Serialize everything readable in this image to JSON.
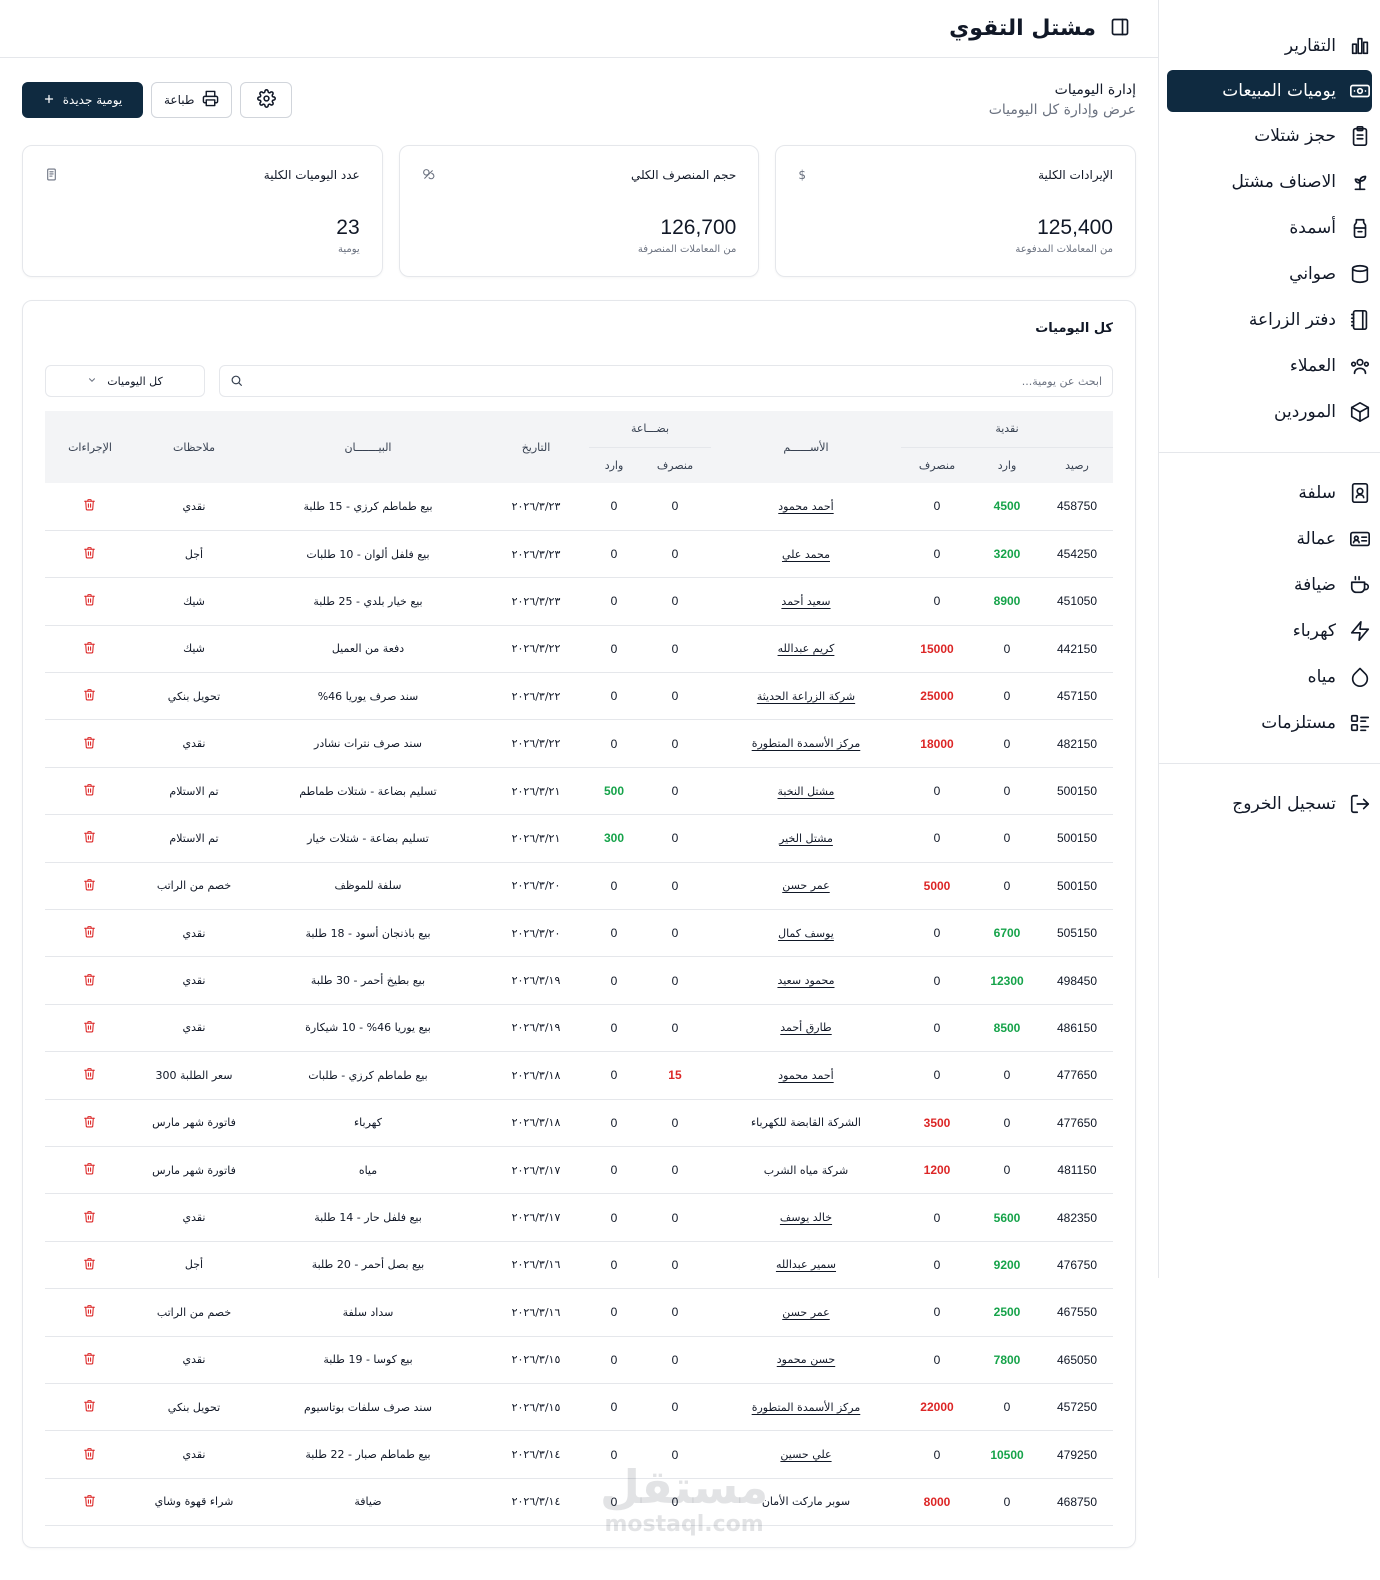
{
  "app": {
    "title": "مشتل التقوي"
  },
  "sidebar": {
    "groups": [
      [
        {
          "label": "التقارير",
          "icon": "bar-chart-icon",
          "active": false
        },
        {
          "label": "يوميات المبيعات",
          "icon": "banknote-icon",
          "active": true
        },
        {
          "label": "حجز شتلات",
          "icon": "clipboard-icon",
          "active": false
        },
        {
          "label": "الاصناف مشتل",
          "icon": "sprout-icon",
          "active": false
        },
        {
          "label": "أسمدة",
          "icon": "fertilizer-icon",
          "active": false
        },
        {
          "label": "صواني",
          "icon": "cylinder-icon",
          "active": false
        },
        {
          "label": "دفتر الزراعة",
          "icon": "notebook-icon",
          "active": false
        },
        {
          "label": "العملاء",
          "icon": "users-icon",
          "active": false
        },
        {
          "label": "الموردين",
          "icon": "package-icon",
          "active": false
        }
      ],
      [
        {
          "label": "سلفة",
          "icon": "contact-icon",
          "active": false
        },
        {
          "label": "عمالة",
          "icon": "id-card-icon",
          "active": false
        },
        {
          "label": "ضيافة",
          "icon": "coffee-icon",
          "active": false
        },
        {
          "label": "كهرباء",
          "icon": "zap-icon",
          "active": false
        },
        {
          "label": "مياه",
          "icon": "droplet-icon",
          "active": false
        },
        {
          "label": "مستلزمات",
          "icon": "list-icon",
          "active": false
        }
      ],
      [
        {
          "label": "تسجيل الخروج",
          "icon": "logout-icon",
          "active": false
        }
      ]
    ]
  },
  "page": {
    "heading": "إدارة اليوميات",
    "subheading": "عرض وإدارة كل اليوميات"
  },
  "toolbar": {
    "new_label": "يومية جديدة",
    "print_label": "طباعة"
  },
  "stats": [
    {
      "label": "الإيرادات الكلية",
      "value": "125,400",
      "note": "من المعاملات المدفوعة",
      "icon": "dollar-icon"
    },
    {
      "label": "حجم المنصرف الكلي",
      "value": "126,700",
      "note": "من المعاملات المنصرفة",
      "icon": "coins-icon"
    },
    {
      "label": "عدد اليوميات الكلية",
      "value": "23",
      "note": "يومية",
      "icon": "receipt-icon"
    }
  ],
  "table": {
    "title": "كل اليوميات",
    "search_placeholder": "ابحث عن يومية...",
    "filter_value": "كل اليوميات",
    "headers": {
      "cash": "نقدية",
      "goods": "بضـــاعة",
      "balance": "رصيد",
      "incoming": "وارد",
      "outgoing": "منصرف",
      "name": "الأســــــم",
      "date": "التاريخ",
      "statement": "البيـــــــان",
      "notes": "ملاحظات",
      "actions": "الإجراءات"
    },
    "colors": {
      "incoming": "#16a34a",
      "outgoing": "#dc2626"
    },
    "rows": [
      {
        "balance": "458750",
        "cash_in": "4500",
        "cash_out": "0",
        "name": "أحمد محمود",
        "linked": true,
        "goods_out": "0",
        "goods_in": "0",
        "date": "٢٠٢٦/٣/٢٣",
        "statement": "بيع طماطم كرزي - 15 طلبة",
        "notes": "نقدي"
      },
      {
        "balance": "454250",
        "cash_in": "3200",
        "cash_out": "0",
        "name": "محمد علي",
        "linked": true,
        "goods_out": "0",
        "goods_in": "0",
        "date": "٢٠٢٦/٣/٢٣",
        "statement": "بيع فلفل ألوان - 10 طلبات",
        "notes": "أجل"
      },
      {
        "balance": "451050",
        "cash_in": "8900",
        "cash_out": "0",
        "name": "سعيد أحمد",
        "linked": true,
        "goods_out": "0",
        "goods_in": "0",
        "date": "٢٠٢٦/٣/٢٣",
        "statement": "بيع خيار بلدي - 25 طلبة",
        "notes": "شيك"
      },
      {
        "balance": "442150",
        "cash_in": "0",
        "cash_out": "15000",
        "name": "كريم عبدالله",
        "linked": true,
        "goods_out": "0",
        "goods_in": "0",
        "date": "٢٠٢٦/٣/٢٢",
        "statement": "دفعة من العميل",
        "notes": "شيك"
      },
      {
        "balance": "457150",
        "cash_in": "0",
        "cash_out": "25000",
        "name": "شركة الزراعة الحديثة",
        "linked": true,
        "goods_out": "0",
        "goods_in": "0",
        "date": "٢٠٢٦/٣/٢٢",
        "statement": "سند صرف يوريا 46%",
        "notes": "تحويل بنكي"
      },
      {
        "balance": "482150",
        "cash_in": "0",
        "cash_out": "18000",
        "name": "مركز الأسمدة المتطورة",
        "linked": true,
        "goods_out": "0",
        "goods_in": "0",
        "date": "٢٠٢٦/٣/٢٢",
        "statement": "سند صرف نترات نشادر",
        "notes": "نقدي"
      },
      {
        "balance": "500150",
        "cash_in": "0",
        "cash_out": "0",
        "name": "مشتل النخبة",
        "linked": true,
        "goods_out": "0",
        "goods_in": "500",
        "date": "٢٠٢٦/٣/٢١",
        "statement": "تسليم بضاعة - شتلات طماطم",
        "notes": "تم الاستلام"
      },
      {
        "balance": "500150",
        "cash_in": "0",
        "cash_out": "0",
        "name": "مشتل الخير",
        "linked": true,
        "goods_out": "0",
        "goods_in": "300",
        "date": "٢٠٢٦/٣/٢١",
        "statement": "تسليم بضاعة - شتلات خيار",
        "notes": "تم الاستلام"
      },
      {
        "balance": "500150",
        "cash_in": "0",
        "cash_out": "5000",
        "name": "عمر حسن",
        "linked": true,
        "goods_out": "0",
        "goods_in": "0",
        "date": "٢٠٢٦/٣/٢٠",
        "statement": "سلفة للموظف",
        "notes": "خصم من الراتب"
      },
      {
        "balance": "505150",
        "cash_in": "6700",
        "cash_out": "0",
        "name": "يوسف كمال",
        "linked": true,
        "goods_out": "0",
        "goods_in": "0",
        "date": "٢٠٢٦/٣/٢٠",
        "statement": "بيع باذنجان أسود - 18 طلبة",
        "notes": "نقدي"
      },
      {
        "balance": "498450",
        "cash_in": "12300",
        "cash_out": "0",
        "name": "محمود سعيد",
        "linked": true,
        "goods_out": "0",
        "goods_in": "0",
        "date": "٢٠٢٦/٣/١٩",
        "statement": "بيع بطيخ أحمر - 30 طلبة",
        "notes": "نقدي"
      },
      {
        "balance": "486150",
        "cash_in": "8500",
        "cash_out": "0",
        "name": "طارق أحمد",
        "linked": true,
        "goods_out": "0",
        "goods_in": "0",
        "date": "٢٠٢٦/٣/١٩",
        "statement": "بيع يوريا 46% - 10 شيكارة",
        "notes": "نقدي"
      },
      {
        "balance": "477650",
        "cash_in": "0",
        "cash_out": "0",
        "name": "أحمد محمود",
        "linked": true,
        "goods_out": "15",
        "goods_in": "0",
        "date": "٢٠٢٦/٣/١٨",
        "statement": "بيع طماطم كرزي - طلبات",
        "notes": "سعر الطلبة 300"
      },
      {
        "balance": "477650",
        "cash_in": "0",
        "cash_out": "3500",
        "name": "الشركة القابضة للكهرباء",
        "linked": false,
        "goods_out": "0",
        "goods_in": "0",
        "date": "٢٠٢٦/٣/١٨",
        "statement": "كهرباء",
        "notes": "فاتورة شهر مارس"
      },
      {
        "balance": "481150",
        "cash_in": "0",
        "cash_out": "1200",
        "name": "شركة مياه الشرب",
        "linked": false,
        "goods_out": "0",
        "goods_in": "0",
        "date": "٢٠٢٦/٣/١٧",
        "statement": "مياه",
        "notes": "فاتورة شهر مارس"
      },
      {
        "balance": "482350",
        "cash_in": "5600",
        "cash_out": "0",
        "name": "خالد يوسف",
        "linked": true,
        "goods_out": "0",
        "goods_in": "0",
        "date": "٢٠٢٦/٣/١٧",
        "statement": "بيع فلفل حار - 14 طلبة",
        "notes": "نقدي"
      },
      {
        "balance": "476750",
        "cash_in": "9200",
        "cash_out": "0",
        "name": "سمير عبدالله",
        "linked": true,
        "goods_out": "0",
        "goods_in": "0",
        "date": "٢٠٢٦/٣/١٦",
        "statement": "بيع بصل أحمر - 20 طلبة",
        "notes": "أجل"
      },
      {
        "balance": "467550",
        "cash_in": "2500",
        "cash_out": "0",
        "name": "عمر حسن",
        "linked": true,
        "goods_out": "0",
        "goods_in": "0",
        "date": "٢٠٢٦/٣/١٦",
        "statement": "سداد سلفة",
        "notes": "خصم من الراتب"
      },
      {
        "balance": "465050",
        "cash_in": "7800",
        "cash_out": "0",
        "name": "حسن محمود",
        "linked": true,
        "goods_out": "0",
        "goods_in": "0",
        "date": "٢٠٢٦/٣/١٥",
        "statement": "بيع كوسا - 19 طلبة",
        "notes": "نقدي"
      },
      {
        "balance": "457250",
        "cash_in": "0",
        "cash_out": "22000",
        "name": "مركز الأسمدة المتطورة",
        "linked": true,
        "goods_out": "0",
        "goods_in": "0",
        "date": "٢٠٢٦/٣/١٥",
        "statement": "سند صرف سلفات بوتاسيوم",
        "notes": "تحويل بنكي"
      },
      {
        "balance": "479250",
        "cash_in": "10500",
        "cash_out": "0",
        "name": "علي حسين",
        "linked": true,
        "goods_out": "0",
        "goods_in": "0",
        "date": "٢٠٢٦/٣/١٤",
        "statement": "بيع طماطم صبار - 22 طلبة",
        "notes": "نقدي"
      },
      {
        "balance": "468750",
        "cash_in": "0",
        "cash_out": "8000",
        "name": "سوبر ماركت الأمان",
        "linked": false,
        "goods_out": "0",
        "goods_in": "0",
        "date": "٢٠٢٦/٣/١٤",
        "statement": "ضيافة",
        "notes": "شراء قهوة وشاي"
      }
    ]
  },
  "watermark": {
    "ar": "مستقل",
    "en": "mostaql.com"
  }
}
